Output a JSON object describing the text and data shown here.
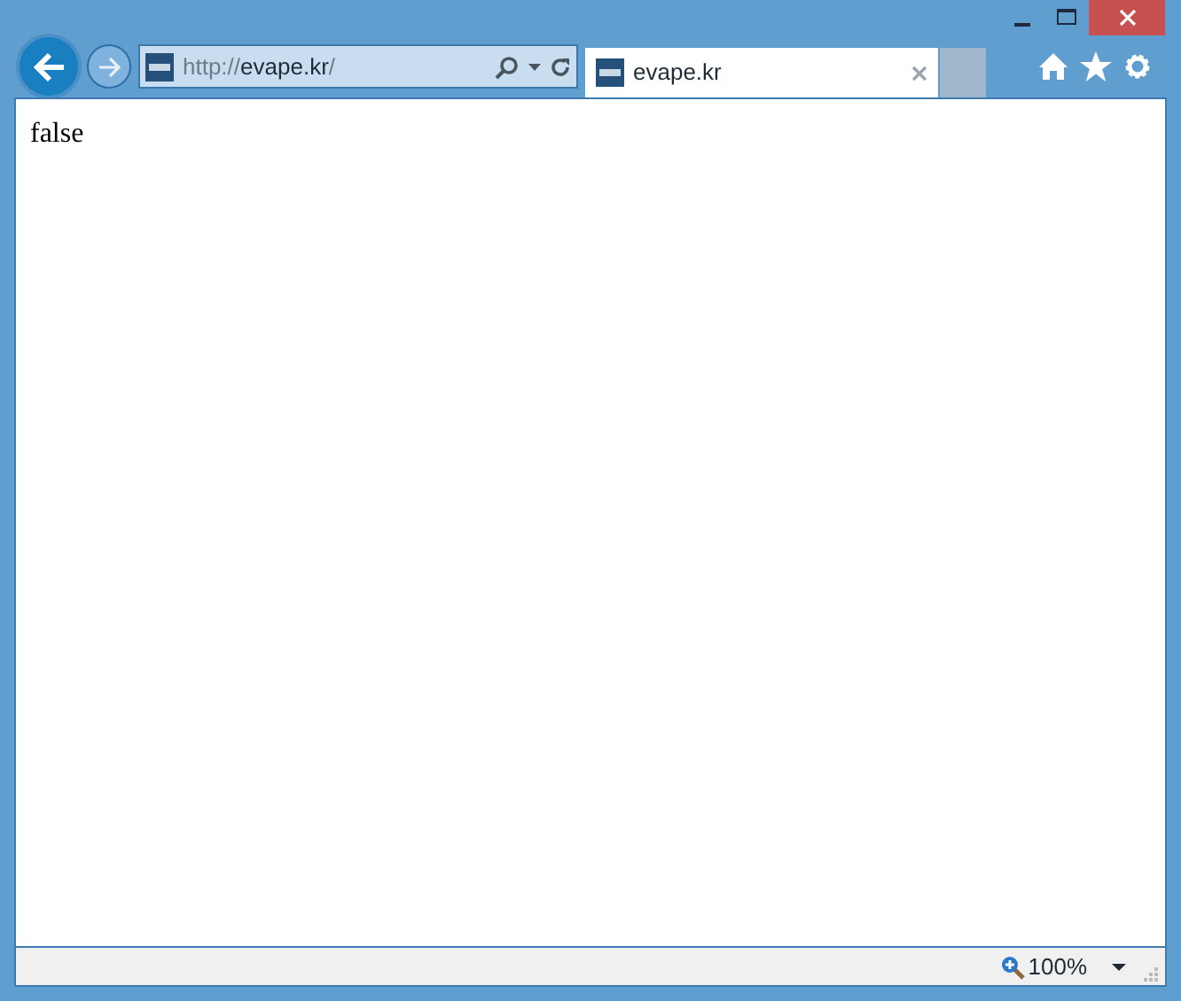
{
  "address_bar": {
    "scheme": "http://",
    "host": "evape.kr",
    "path": "/"
  },
  "tabs": [
    {
      "title": "evape.kr",
      "selected": true
    }
  ],
  "page": {
    "text": "false"
  },
  "status_bar": {
    "zoom": "100%"
  }
}
